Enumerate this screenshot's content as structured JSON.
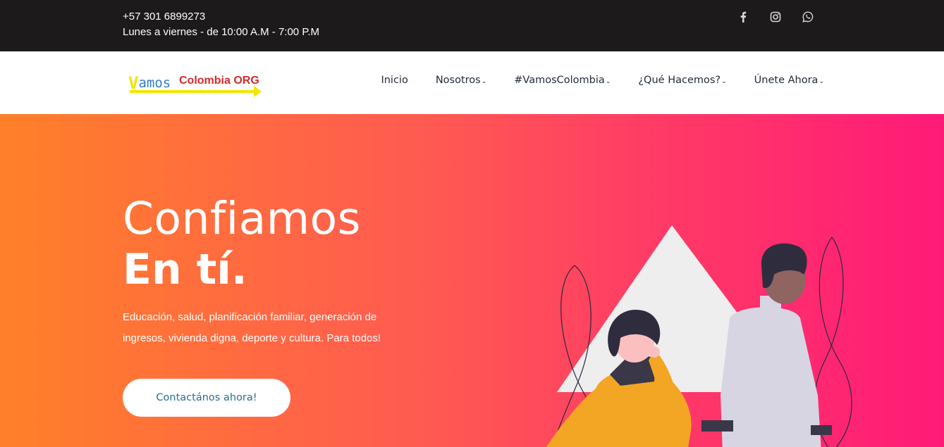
{
  "topbar": {
    "phone": "+57 301 6899273",
    "hours": "Lunes a viernes - de 10:00 A.M - 7:00 P.M",
    "socials": [
      {
        "name": "facebook-icon"
      },
      {
        "name": "instagram-icon"
      },
      {
        "name": "whatsapp-icon"
      }
    ]
  },
  "header": {
    "logo": {
      "part1": "Vamos",
      "part2": "Colombia ORG"
    },
    "nav": [
      {
        "label": "Inicio",
        "dropdown": false
      },
      {
        "label": "Nosotros",
        "dropdown": true
      },
      {
        "label": "#VamosColombia",
        "dropdown": true
      },
      {
        "label": "¿Qué Hacemos?",
        "dropdown": true
      },
      {
        "label": "Únete Ahora",
        "dropdown": true
      }
    ]
  },
  "hero": {
    "title_light": "Confiamos",
    "title_bold": "En tí.",
    "description": "Educación, salud, planificación familiar, generación de ingresos, vivienda digna, deporte y cultura. Para todos!",
    "cta_label": "Contactános ahora!"
  },
  "colors": {
    "topbar_bg": "#1c1a1a",
    "hero_gradient_start": "#ff8029",
    "hero_gradient_end": "#ff1a78",
    "cta_text": "#2b6e8f"
  }
}
